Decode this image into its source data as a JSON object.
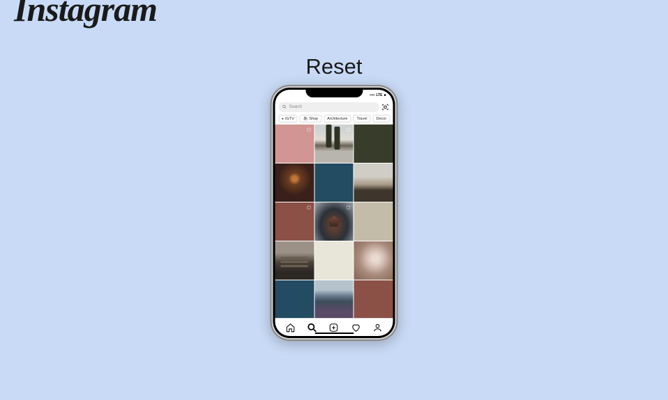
{
  "logo_text": "Instagram",
  "heading": "Reset",
  "status": {
    "signal": "▪▪▪▪",
    "carrier": "LTE",
    "battery": "■"
  },
  "search": {
    "placeholder": "Search"
  },
  "chips": [
    {
      "icon": "▸",
      "label": "IGTV"
    },
    {
      "icon": "🛍",
      "label": "Shop"
    },
    {
      "icon": "",
      "label": "Architecture"
    },
    {
      "icon": "",
      "label": "Travel"
    },
    {
      "icon": "",
      "label": "Decor"
    }
  ],
  "grid": {
    "rows": 5,
    "cols": 3,
    "cells": [
      {
        "kind": "color",
        "color": "#d19593",
        "carousel": true
      },
      {
        "kind": "photo",
        "desc": "trees-courtyard",
        "carousel": true
      },
      {
        "kind": "color",
        "color": "#383d2b"
      },
      {
        "kind": "photo",
        "desc": "spiral-structure"
      },
      {
        "kind": "color",
        "color": "#234b61"
      },
      {
        "kind": "photo",
        "desc": "glass-interior"
      },
      {
        "kind": "color",
        "color": "#8b5146",
        "carousel": true
      },
      {
        "kind": "photo",
        "desc": "pagoda",
        "carousel": true
      },
      {
        "kind": "color",
        "color": "#c3bca9"
      },
      {
        "kind": "photo",
        "desc": "train-tracks"
      },
      {
        "kind": "color",
        "color": "#e8e5d9"
      },
      {
        "kind": "photo",
        "desc": "flower-table"
      },
      {
        "kind": "color",
        "color": "#234b61"
      },
      {
        "kind": "photo",
        "desc": "storm-field"
      },
      {
        "kind": "color",
        "color": "#8b5146"
      }
    ]
  },
  "tabs": {
    "home": "home",
    "search": "search",
    "create": "create",
    "activity": "activity",
    "profile": "profile",
    "active": "search"
  }
}
